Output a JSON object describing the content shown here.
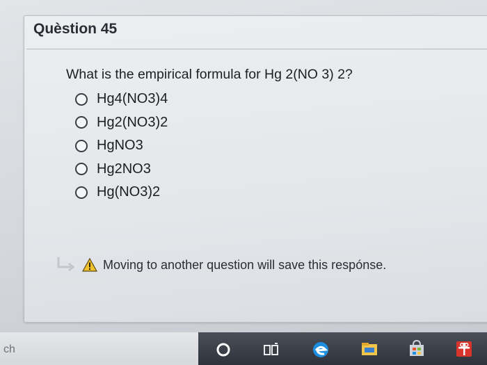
{
  "question": {
    "header": "Quèstion 45",
    "text": "What is the empirical formula for Hg 2(NO 3) 2?",
    "options": [
      {
        "label": "Hg4(NO3)4"
      },
      {
        "label": "Hg2(NO3)2"
      },
      {
        "label": "HgNO3"
      },
      {
        "label": "Hg2NO3"
      },
      {
        "label": "Hg(NO3)2"
      }
    ],
    "selected_index": null
  },
  "notice": {
    "icon": "warning-icon",
    "text": "Moving to another question will save this respónse."
  },
  "taskbar": {
    "search_text": "ch",
    "icons": [
      "cortana-circle-icon",
      "task-view-icon",
      "edge-browser-icon",
      "file-explorer-icon",
      "store-icon",
      "gift-app-icon"
    ]
  },
  "colors": {
    "warning_fill": "#f2c12e",
    "edge_blue": "#1e8fe0",
    "explorer_yellow": "#f4c54b",
    "gift_red": "#d9342b"
  }
}
